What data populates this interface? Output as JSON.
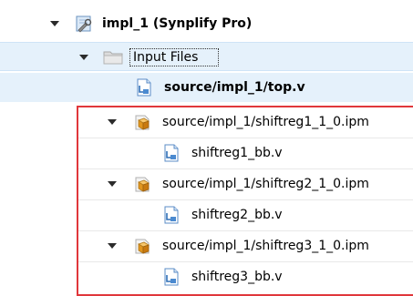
{
  "tree": {
    "project": {
      "label": "impl_1 (Synplify Pro)",
      "icon": "project-wrench-icon"
    },
    "input_files": {
      "label": "Input Files",
      "icon": "folder-icon"
    },
    "top_file": {
      "label": "source/impl_1/top.v",
      "icon": "verilog-file-icon"
    },
    "ipm_items": [
      {
        "label": "source/impl_1/shiftreg1_1_0.ipm",
        "icon": "ip-module-icon",
        "child": {
          "label": "shiftreg1_bb.v",
          "icon": "verilog-file-icon"
        }
      },
      {
        "label": "source/impl_1/shiftreg2_1_0.ipm",
        "icon": "ip-module-icon",
        "child": {
          "label": "shiftreg2_bb.v",
          "icon": "verilog-file-icon"
        }
      },
      {
        "label": "source/impl_1/shiftreg3_1_0.ipm",
        "icon": "ip-module-icon",
        "child": {
          "label": "shiftreg3_bb.v",
          "icon": "verilog-file-icon"
        }
      }
    ]
  },
  "colors": {
    "selection_bg": "#e5f1fb",
    "highlight_border": "#e0373b"
  }
}
